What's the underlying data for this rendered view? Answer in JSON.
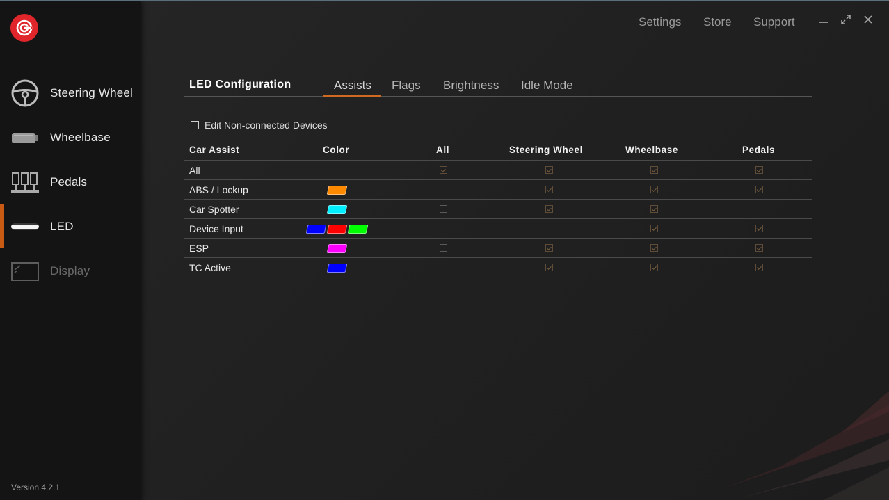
{
  "app": {
    "version": "Version 4.2.1"
  },
  "topbar": {
    "links": [
      "Settings",
      "Store",
      "Support"
    ]
  },
  "sidebar": {
    "items": [
      {
        "label": "Steering Wheel",
        "icon": "steering-wheel-icon"
      },
      {
        "label": "Wheelbase",
        "icon": "wheelbase-icon"
      },
      {
        "label": "Pedals",
        "icon": "pedals-icon"
      },
      {
        "label": "LED",
        "icon": "led-icon",
        "active": true
      },
      {
        "label": "Display",
        "icon": "display-icon",
        "disabled": true
      }
    ]
  },
  "panel": {
    "title": "LED Configuration",
    "tabs": [
      "Assists",
      "Flags",
      "Brightness",
      "Idle Mode"
    ],
    "active_tab": "Assists",
    "edit_noncon_label": "Edit Non-connected Devices",
    "edit_noncon_checked": false
  },
  "table": {
    "headers": [
      "Car Assist",
      "Color",
      "All",
      "Steering Wheel",
      "Wheelbase",
      "Pedals"
    ],
    "rows": [
      {
        "name": "All",
        "colors": [],
        "all": "checked",
        "steering_wheel": "checked",
        "wheelbase": "checked",
        "pedals": "checked"
      },
      {
        "name": "ABS / Lockup",
        "colors": [
          "#ff8a00"
        ],
        "all": "unchecked",
        "steering_wheel": "checked",
        "wheelbase": "checked",
        "pedals": "checked"
      },
      {
        "name": "Car Spotter",
        "colors": [
          "#00f0ff"
        ],
        "all": "unchecked",
        "steering_wheel": "checked",
        "wheelbase": "checked",
        "pedals": "none"
      },
      {
        "name": "Device Input",
        "colors": [
          "#0000ff",
          "#ff0000",
          "#00ff00"
        ],
        "all": "unchecked",
        "steering_wheel": "none",
        "wheelbase": "checked",
        "pedals": "checked"
      },
      {
        "name": "ESP",
        "colors": [
          "#ff00ff"
        ],
        "all": "unchecked",
        "steering_wheel": "checked",
        "wheelbase": "checked",
        "pedals": "checked"
      },
      {
        "name": "TC Active",
        "colors": [
          "#0000ff"
        ],
        "all": "unchecked",
        "steering_wheel": "checked",
        "wheelbase": "checked",
        "pedals": "checked"
      }
    ]
  },
  "colors": {
    "accent": "#d06a20",
    "logo": "#e0262a"
  }
}
